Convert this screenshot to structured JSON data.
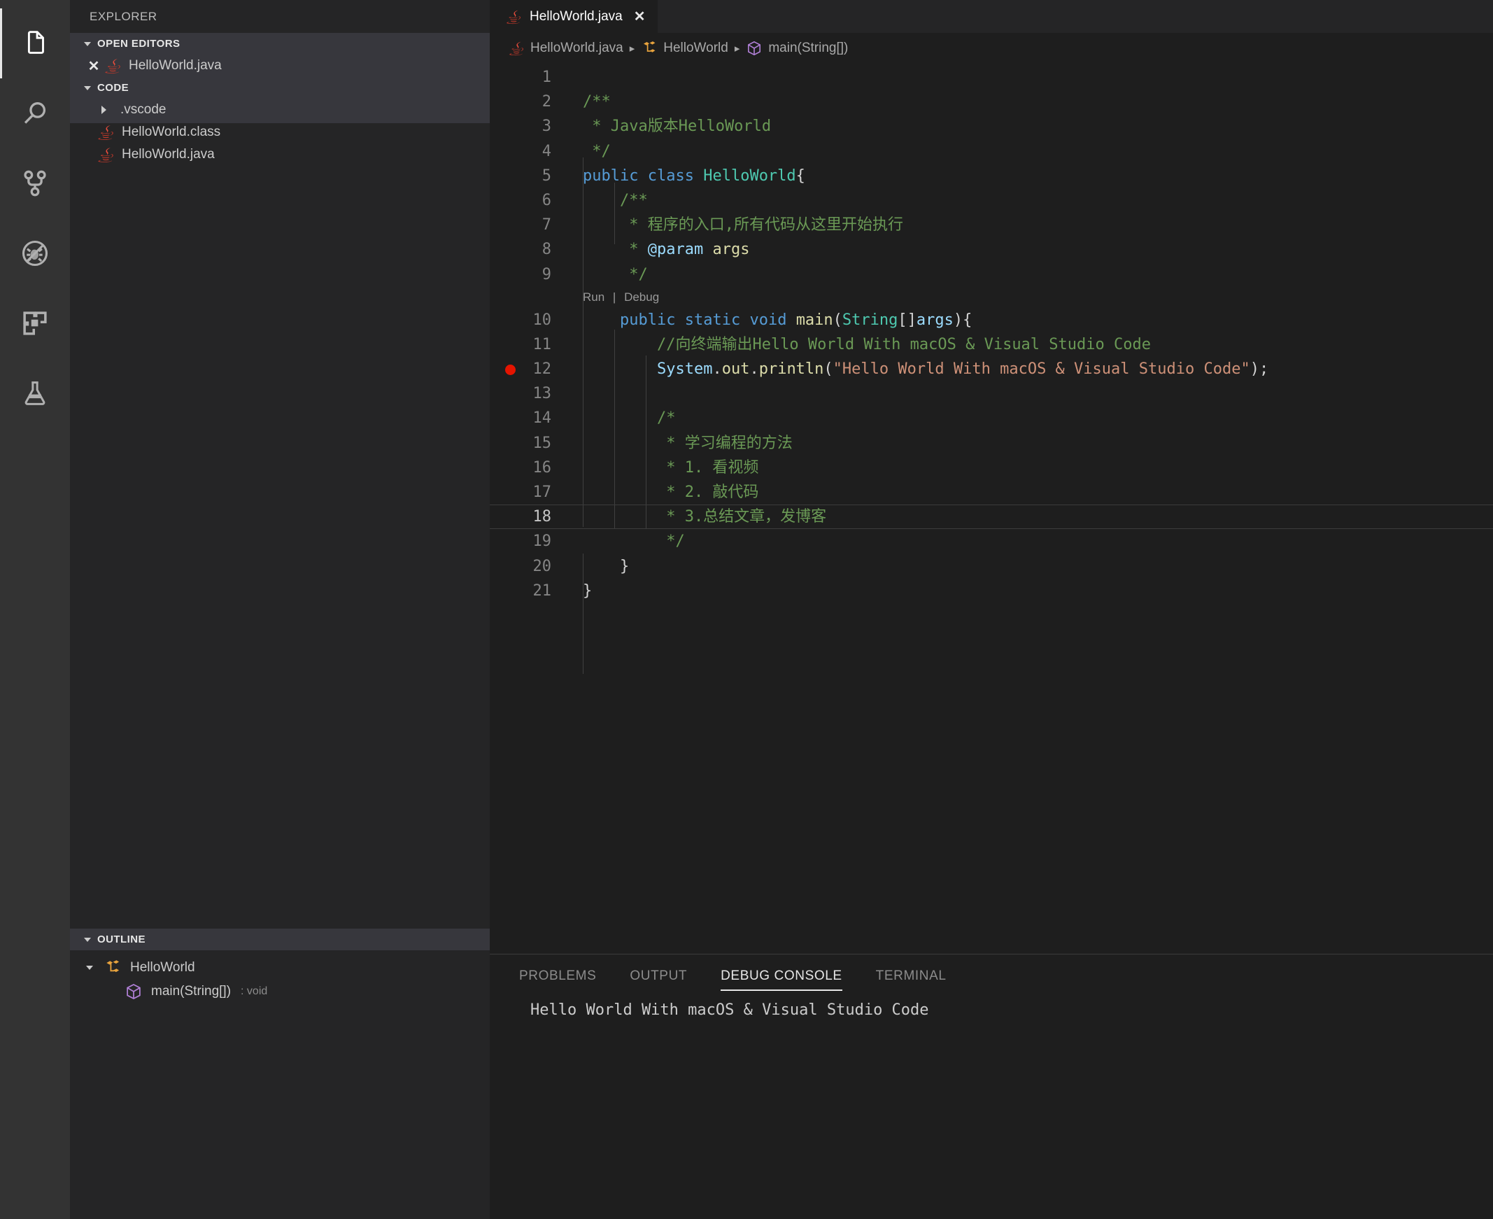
{
  "activitybar": {
    "items": [
      {
        "name": "explorer",
        "icon": "files-icon",
        "active": true
      },
      {
        "name": "search",
        "icon": "search-icon",
        "active": false
      },
      {
        "name": "source-control",
        "icon": "source-control-icon",
        "active": false
      },
      {
        "name": "run-and-debug",
        "icon": "debug-disabled-icon",
        "active": false
      },
      {
        "name": "extensions",
        "icon": "extensions-icon",
        "active": false
      },
      {
        "name": "testing",
        "icon": "beaker-icon",
        "active": false
      }
    ]
  },
  "sidebar": {
    "title": "EXPLORER",
    "open_editors": {
      "label": "OPEN EDITORS",
      "items": [
        {
          "label": "HelloWorld.java",
          "icon": "java-icon",
          "close": "✕"
        }
      ]
    },
    "folder": {
      "label": "CODE",
      "items": [
        {
          "label": ".vscode",
          "icon": "folder-chevron-icon",
          "type": "folder"
        },
        {
          "label": "HelloWorld.class",
          "icon": "java-icon",
          "type": "file"
        },
        {
          "label": "HelloWorld.java",
          "icon": "java-icon",
          "type": "file"
        }
      ]
    },
    "outline": {
      "label": "OUTLINE",
      "items": [
        {
          "label": "HelloWorld",
          "icon": "class-icon",
          "detail": "",
          "indent": 0
        },
        {
          "label": "main(String[])",
          "icon": "method-icon",
          "detail": ": void",
          "indent": 1
        }
      ]
    }
  },
  "editor": {
    "tab": {
      "label": "HelloWorld.java",
      "icon": "java-icon",
      "close": "✕"
    },
    "breadcrumbs": [
      {
        "label": "HelloWorld.java",
        "icon": "java-icon"
      },
      {
        "label": "HelloWorld",
        "icon": "class-icon"
      },
      {
        "label": "main(String[])",
        "icon": "method-icon"
      }
    ],
    "separator": "▸",
    "codelens": {
      "run": "Run",
      "sep": "|",
      "debug": "Debug"
    },
    "breakpoint_line": 12,
    "current_line": 18,
    "lines": [
      {
        "n": 1,
        "text": ""
      },
      {
        "n": 2,
        "text": "/**"
      },
      {
        "n": 3,
        "text": " * Java版本HelloWorld"
      },
      {
        "n": 4,
        "text": " */"
      },
      {
        "n": 5,
        "text": "public class HelloWorld{"
      },
      {
        "n": 6,
        "text": "    /**"
      },
      {
        "n": 7,
        "text": "     * 程序的入口,所有代码从这里开始执行"
      },
      {
        "n": 8,
        "text": "     * @param args"
      },
      {
        "n": 9,
        "text": "     */"
      },
      {
        "n": 10,
        "text": "    public static void main(String[]args){"
      },
      {
        "n": 11,
        "text": "        //向终端输出Hello World With macOS & Visual Studio Code"
      },
      {
        "n": 12,
        "text": "        System.out.println(\"Hello World With macOS & Visual Studio Code\");"
      },
      {
        "n": 13,
        "text": ""
      },
      {
        "n": 14,
        "text": "        /*"
      },
      {
        "n": 15,
        "text": "         * 学习编程的方法"
      },
      {
        "n": 16,
        "text": "         * 1. 看视频"
      },
      {
        "n": 17,
        "text": "         * 2. 敲代码"
      },
      {
        "n": 18,
        "text": "         * 3.总结文章，发博客"
      },
      {
        "n": 19,
        "text": "         */"
      },
      {
        "n": 20,
        "text": "    }"
      },
      {
        "n": 21,
        "text": "}"
      }
    ]
  },
  "panel": {
    "tabs": [
      {
        "label": "PROBLEMS",
        "active": false
      },
      {
        "label": "OUTPUT",
        "active": false
      },
      {
        "label": "DEBUG CONSOLE",
        "active": true
      },
      {
        "label": "TERMINAL",
        "active": false
      }
    ],
    "console_output": "Hello World With macOS & Visual Studio Code"
  },
  "colors": {
    "activitybar_bg": "#333333",
    "sidebar_bg": "#252526",
    "editor_bg": "#1e1e1e",
    "accent": "#e7e7e7",
    "breakpoint": "#e51400",
    "keyword": "#569cd6",
    "type": "#4ec9b0",
    "comment": "#6a9955",
    "string": "#ce9178",
    "function": "#dcdcaa",
    "variable": "#9cdcfe"
  }
}
